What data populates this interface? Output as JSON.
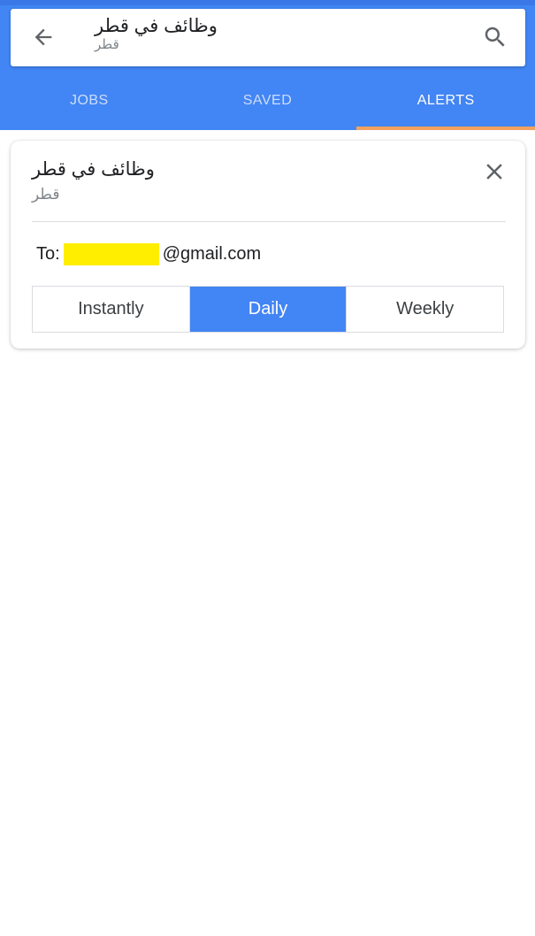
{
  "search": {
    "query": "وظائف في قطر",
    "location": "قطر",
    "back_icon": "arrow-back-icon",
    "search_icon": "search-icon"
  },
  "tabs": [
    {
      "label": "JOBS",
      "active": false
    },
    {
      "label": "SAVED",
      "active": false
    },
    {
      "label": "ALERTS",
      "active": true
    }
  ],
  "alert": {
    "title": "وظائف في قطر",
    "location": "قطر",
    "to_label": "To:",
    "email_domain": "@gmail.com",
    "close_icon": "close-icon",
    "frequency_options": [
      "Instantly",
      "Daily",
      "Weekly"
    ],
    "selected_frequency": "Daily"
  },
  "colors": {
    "primary": "#4285f4",
    "tab_indicator": "#f4a15d",
    "redaction": "#ffee00"
  }
}
